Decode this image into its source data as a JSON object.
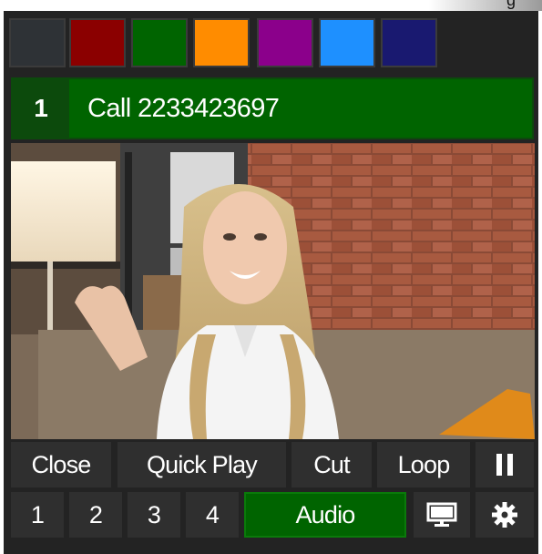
{
  "swatches": [
    {
      "name": "none",
      "color": "#2e3236"
    },
    {
      "name": "red",
      "color": "#8b0000"
    },
    {
      "name": "green",
      "color": "#006400"
    },
    {
      "name": "orange",
      "color": "#ff8c00"
    },
    {
      "name": "purple",
      "color": "#8b008b"
    },
    {
      "name": "blue",
      "color": "#1e90ff"
    },
    {
      "name": "navy",
      "color": "#191970"
    }
  ],
  "input": {
    "number": "1",
    "title": "Call 2233423697",
    "preview": "video-feed"
  },
  "buttons_row1": {
    "close": "Close",
    "quick_play": "Quick Play",
    "cut": "Cut",
    "loop": "Loop",
    "pause_icon": "pause-icon"
  },
  "buttons_row2": {
    "overlays": [
      "1",
      "2",
      "3",
      "4"
    ],
    "audio": "Audio",
    "audio_active": true,
    "monitor_icon": "monitor-icon",
    "settings_icon": "gear-icon"
  }
}
